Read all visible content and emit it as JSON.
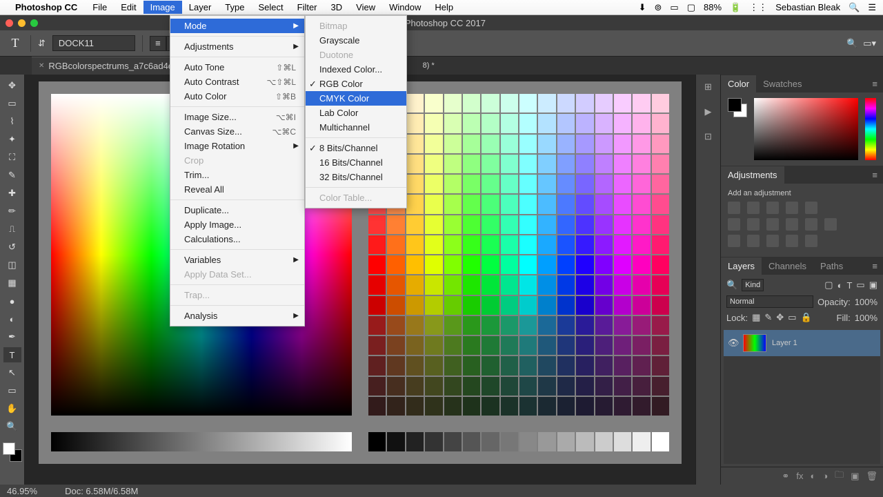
{
  "menubar": {
    "apple": "",
    "app": "Photoshop CC",
    "items": [
      "File",
      "Edit",
      "Image",
      "Layer",
      "Type",
      "Select",
      "Filter",
      "3D",
      "View",
      "Window",
      "Help"
    ],
    "active": "Image",
    "battery": "88%",
    "user": "Sebastian Bleak"
  },
  "titlebar": {
    "title": "e Photoshop CC 2017"
  },
  "optionsbar": {
    "tool_glyph": "T",
    "font": "DOCK11",
    "alignments": [
      "left",
      "center",
      "right"
    ]
  },
  "doctab": {
    "name": "RGBcolorspectrums_a7c6ad4e-6",
    "suffix": "8) *"
  },
  "image_menu": [
    {
      "t": "Mode",
      "arrow": true,
      "hl": true
    },
    {
      "sep": true
    },
    {
      "t": "Adjustments",
      "arrow": true
    },
    {
      "sep": true
    },
    {
      "t": "Auto Tone",
      "sc": "⇧⌘L"
    },
    {
      "t": "Auto Contrast",
      "sc": "⌥⇧⌘L"
    },
    {
      "t": "Auto Color",
      "sc": "⇧⌘B"
    },
    {
      "sep": true
    },
    {
      "t": "Image Size...",
      "sc": "⌥⌘I"
    },
    {
      "t": "Canvas Size...",
      "sc": "⌥⌘C"
    },
    {
      "t": "Image Rotation",
      "arrow": true
    },
    {
      "t": "Crop",
      "disabled": true
    },
    {
      "t": "Trim..."
    },
    {
      "t": "Reveal All"
    },
    {
      "sep": true
    },
    {
      "t": "Duplicate..."
    },
    {
      "t": "Apply Image..."
    },
    {
      "t": "Calculations..."
    },
    {
      "sep": true
    },
    {
      "t": "Variables",
      "arrow": true
    },
    {
      "t": "Apply Data Set...",
      "disabled": true
    },
    {
      "sep": true
    },
    {
      "t": "Trap...",
      "disabled": true
    },
    {
      "sep": true
    },
    {
      "t": "Analysis",
      "arrow": true
    }
  ],
  "mode_submenu": [
    {
      "t": "Bitmap",
      "disabled": true
    },
    {
      "t": "Grayscale"
    },
    {
      "t": "Duotone",
      "disabled": true
    },
    {
      "t": "Indexed Color..."
    },
    {
      "t": "RGB Color",
      "chk": true
    },
    {
      "t": "CMYK Color",
      "hl": true
    },
    {
      "t": "Lab Color"
    },
    {
      "t": "Multichannel"
    },
    {
      "sep": true
    },
    {
      "t": "8 Bits/Channel",
      "chk": true
    },
    {
      "t": "16 Bits/Channel"
    },
    {
      "t": "32 Bits/Channel"
    },
    {
      "sep": true
    },
    {
      "t": "Color Table...",
      "disabled": true
    }
  ],
  "panels": {
    "color_tab": "Color",
    "swatches_tab": "Swatches",
    "adjustments_tab": "Adjustments",
    "adjustments_label": "Add an adjustment",
    "layers_tab": "Layers",
    "channels_tab": "Channels",
    "paths_tab": "Paths",
    "kind_label": "Kind",
    "blend_mode": "Normal",
    "opacity_label": "Opacity:",
    "opacity_value": "100%",
    "lock_label": "Lock:",
    "fill_label": "Fill:",
    "fill_value": "100%",
    "layer1": "Layer 1"
  },
  "statusbar": {
    "zoom": "46.95%",
    "docsize": "Doc: 6.58M/6.58M"
  },
  "tools": [
    "move",
    "marquee",
    "lasso",
    "magic-wand",
    "crop",
    "eyedropper",
    "heal",
    "brush",
    "stamp",
    "history-brush",
    "eraser",
    "gradient",
    "blur",
    "dodge",
    "pen",
    "type",
    "path",
    "rectangle",
    "hand",
    "zoom"
  ]
}
